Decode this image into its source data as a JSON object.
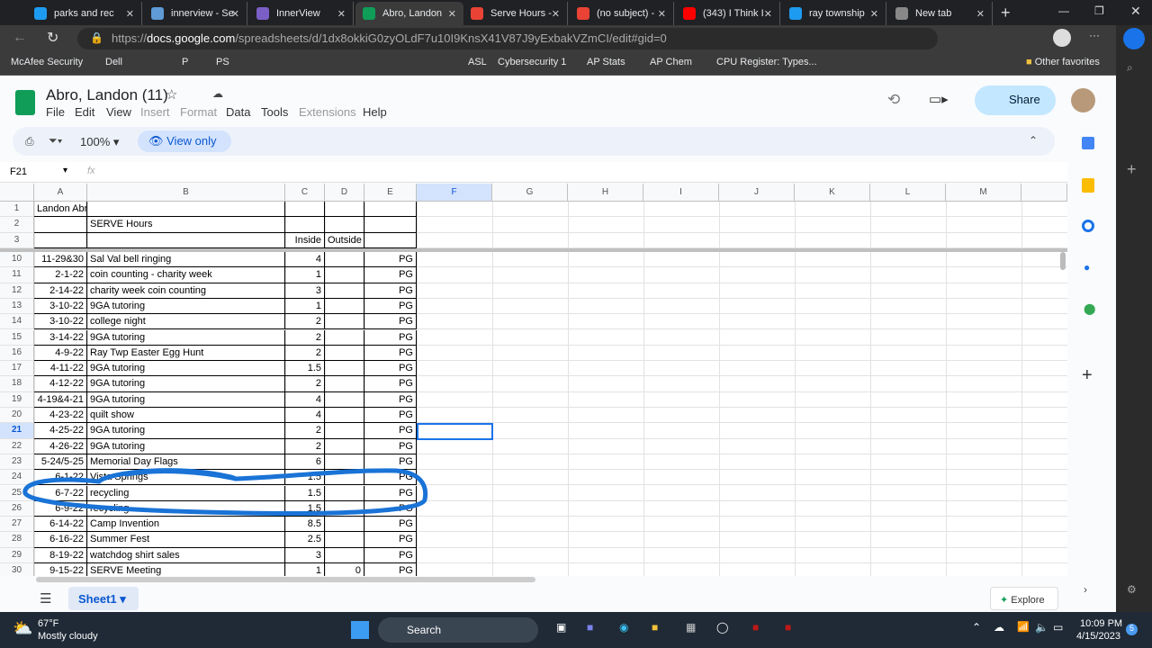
{
  "browser": {
    "tabs": [
      {
        "label": "parks and rec",
        "icon": "twitter-icon",
        "color": "#1d9bf0"
      },
      {
        "label": "innerview - Se",
        "icon": "search-icon",
        "color": "#5f9bd6"
      },
      {
        "label": "InnerView",
        "icon": "innerview-icon",
        "color": "#7b5fc6"
      },
      {
        "label": "Abro, Landon",
        "icon": "sheets-icon",
        "color": "#0f9d58"
      },
      {
        "label": "Serve Hours -",
        "icon": "gmail-icon",
        "color": "#ea4335"
      },
      {
        "label": "(no subject) -",
        "icon": "gmail-icon",
        "color": "#ea4335"
      },
      {
        "label": "(343) I Think I",
        "icon": "youtube-icon",
        "color": "#ff0000"
      },
      {
        "label": "ray township",
        "icon": "twitter-icon",
        "color": "#1d9bf0"
      },
      {
        "label": "New tab",
        "icon": "newtab-icon",
        "color": "#888"
      }
    ],
    "url_prefix": "https://",
    "url_domain": "docs.google.com",
    "url_path": "/spreadsheets/d/1dx8okkiG0zyOLdF7u10I9KnsX41V87J9yExbakVZmCI/edit#gid=0",
    "bookmarks": [
      "McAfee Security",
      "Dell",
      "P",
      "PS",
      "ASL",
      "Cybersecurity 1",
      "AP Stats",
      "AP Chem",
      "CPU Register: Types..."
    ],
    "other_favorites": "Other favorites"
  },
  "doc": {
    "title": "Abro, Landon (11)",
    "menus": [
      "File",
      "Edit",
      "View",
      "Insert",
      "Format",
      "Data",
      "Tools",
      "Extensions",
      "Help"
    ],
    "share": "Share",
    "zoom": "100%",
    "view_only": "View only",
    "cell_ref": "F21",
    "fx": "fx",
    "columns": [
      "A",
      "B",
      "C",
      "D",
      "E",
      "F",
      "G",
      "H",
      "I",
      "J",
      "K",
      "L",
      "M"
    ],
    "header_rows": [
      {
        "n": "1",
        "a": "Landon Abro"
      },
      {
        "n": "2",
        "b": "SERVE Hours"
      },
      {
        "n": "3",
        "c": "Inside",
        "d": "Outside"
      }
    ],
    "rows": [
      {
        "n": "10",
        "a": "11-29&30",
        "b": "Sal Val bell ringing",
        "c": "4",
        "d": "",
        "e": "PG"
      },
      {
        "n": "11",
        "a": "2-1-22",
        "b": "coin counting - charity week",
        "c": "1",
        "d": "",
        "e": "PG"
      },
      {
        "n": "12",
        "a": "2-14-22",
        "b": "charity week coin counting",
        "c": "3",
        "d": "",
        "e": "PG"
      },
      {
        "n": "13",
        "a": "3-10-22",
        "b": "9GA tutoring",
        "c": "1",
        "d": "",
        "e": "PG"
      },
      {
        "n": "14",
        "a": "3-10-22",
        "b": "college night",
        "c": "2",
        "d": "",
        "e": "PG"
      },
      {
        "n": "15",
        "a": "3-14-22",
        "b": "9GA tutoring",
        "c": "2",
        "d": "",
        "e": "PG"
      },
      {
        "n": "16",
        "a": "4-9-22",
        "b": "Ray Twp Easter Egg Hunt",
        "c": "2",
        "d": "",
        "e": "PG"
      },
      {
        "n": "17",
        "a": "4-11-22",
        "b": "9GA tutoring",
        "c": "1.5",
        "d": "",
        "e": "PG"
      },
      {
        "n": "18",
        "a": "4-12-22",
        "b": "9GA tutoring",
        "c": "2",
        "d": "",
        "e": "PG"
      },
      {
        "n": "19",
        "a": "4-19&4-21",
        "b": "9GA tutoring",
        "c": "4",
        "d": "",
        "e": "PG"
      },
      {
        "n": "20",
        "a": "4-23-22",
        "b": "quilt show",
        "c": "4",
        "d": "",
        "e": "PG"
      },
      {
        "n": "21",
        "a": "4-25-22",
        "b": "9GA tutoring",
        "c": "2",
        "d": "",
        "e": "PG"
      },
      {
        "n": "22",
        "a": "4-26-22",
        "b": "9GA tutoring",
        "c": "2",
        "d": "",
        "e": "PG"
      },
      {
        "n": "23",
        "a": "5-24/5-25",
        "b": "Memorial Day Flags",
        "c": "6",
        "d": "",
        "e": "PG"
      },
      {
        "n": "24",
        "a": "6-1-22",
        "b": "Vista Springs",
        "c": "1.5",
        "d": "",
        "e": "PG"
      },
      {
        "n": "25",
        "a": "6-7-22",
        "b": "recycling",
        "c": "1.5",
        "d": "",
        "e": "PG"
      },
      {
        "n": "26",
        "a": "6-9-22",
        "b": "recycling",
        "c": "1.5",
        "d": "",
        "e": "PG"
      },
      {
        "n": "27",
        "a": "6-14-22",
        "b": "Camp Invention",
        "c": "8.5",
        "d": "",
        "e": "PG"
      },
      {
        "n": "28",
        "a": "6-16-22",
        "b": "Summer Fest",
        "c": "2.5",
        "d": "",
        "e": "PG"
      },
      {
        "n": "29",
        "a": "8-19-22",
        "b": "watchdog shirt sales",
        "c": "3",
        "d": "",
        "e": "PG"
      },
      {
        "n": "30",
        "a": "9-15-22",
        "b": "SERVE Meeting",
        "c": "1",
        "d": "0",
        "e": "PG"
      }
    ],
    "sheet_tab": "Sheet1",
    "explore": "Explore"
  },
  "taskbar": {
    "temp": "67°F",
    "weather": "Mostly cloudy",
    "search": "Search",
    "time": "10:09 PM",
    "date": "4/15/2023",
    "notif": "5"
  }
}
